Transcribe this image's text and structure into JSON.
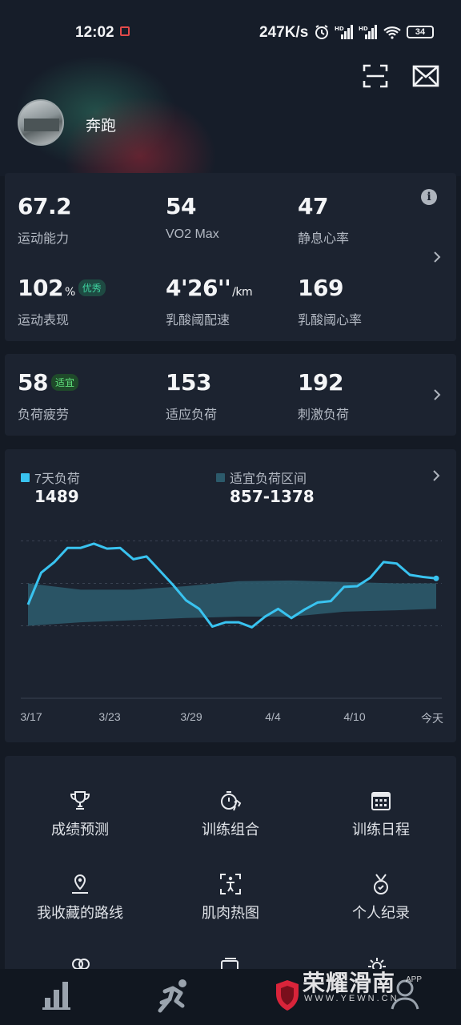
{
  "status_bar": {
    "time": "12:02",
    "net_speed": "247K/s",
    "battery": "34",
    "icons": [
      "alarm-icon",
      "signal-hd-icon",
      "signal-hd-icon",
      "wifi-icon",
      "battery-icon"
    ]
  },
  "header": {
    "username": "奔跑",
    "icons": [
      "scan-icon",
      "mail-icon"
    ]
  },
  "ability": {
    "metrics": [
      {
        "value": "67.2",
        "unit": "",
        "label": "运动能力",
        "badge": ""
      },
      {
        "value": "54",
        "unit": "",
        "label": "VO2 Max",
        "badge": ""
      },
      {
        "value": "47",
        "unit": "",
        "label": "静息心率",
        "badge": ""
      },
      {
        "value": "102",
        "unit": "%",
        "label": "运动表现",
        "badge": "优秀"
      },
      {
        "value": "4'26''",
        "unit": "/km",
        "label": "乳酸阈配速",
        "badge": ""
      },
      {
        "value": "169",
        "unit": "",
        "label": "乳酸阈心率",
        "badge": ""
      }
    ]
  },
  "load": {
    "metrics": [
      {
        "value": "58",
        "label": "负荷疲劳",
        "badge": "适宜"
      },
      {
        "value": "153",
        "label": "适应负荷",
        "badge": ""
      },
      {
        "value": "192",
        "label": "刺激负荷",
        "badge": ""
      }
    ]
  },
  "colors": {
    "accent_line": "#39c3f0",
    "band_fill": "#2c5a6b",
    "card_bg": "#1c2330",
    "badge_teal": "#3ed4a0",
    "badge_green": "#5fe07c"
  },
  "chart_data": {
    "type": "area",
    "legend": [
      {
        "label": "7天负荷",
        "value": "1489",
        "color": "#39c3f0"
      },
      {
        "label": "适宜负荷区间",
        "value": "857-1378",
        "color": "#2c5a6b"
      }
    ],
    "x_tick_labels": [
      "3/17",
      "3/23",
      "3/29",
      "4/4",
      "4/10",
      "今天"
    ],
    "ylim": [
      0,
      2600
    ],
    "grid": true,
    "series": [
      {
        "name": "7天负荷",
        "x": [
          0,
          1,
          2,
          3,
          4,
          5,
          6,
          7,
          8,
          9,
          10,
          11,
          12,
          13,
          14,
          15,
          16,
          17,
          18,
          19,
          20,
          21,
          22,
          23,
          24,
          25,
          26,
          27,
          28,
          29,
          30,
          31
        ],
        "values": [
          1300,
          1750,
          1900,
          2100,
          2100,
          2160,
          2090,
          2100,
          1940,
          1980,
          1780,
          1580,
          1360,
          1240,
          990,
          1050,
          1050,
          980,
          1130,
          1240,
          1110,
          1230,
          1330,
          1350,
          1550,
          1560,
          1680,
          1900,
          1880,
          1720,
          1690,
          1670
        ]
      },
      {
        "name": "适宜负荷区间",
        "x": [
          0,
          4,
          8,
          12,
          16,
          20,
          24,
          28,
          31
        ],
        "upper": [
          1600,
          1510,
          1510,
          1560,
          1630,
          1640,
          1620,
          1600,
          1600
        ],
        "lower": [
          1000,
          1050,
          1080,
          1110,
          1130,
          1130,
          1200,
          1220,
          1240
        ]
      }
    ]
  },
  "menu": {
    "items": [
      {
        "label": "成绩预测",
        "icon": "trophy-icon"
      },
      {
        "label": "训练组合",
        "icon": "stopwatch-run-icon"
      },
      {
        "label": "训练日程",
        "icon": "calendar-icon"
      },
      {
        "label": "我收藏的路线",
        "icon": "route-pin-icon"
      },
      {
        "label": "肌肉热图",
        "icon": "muscle-scan-icon"
      },
      {
        "label": "个人纪录",
        "icon": "medal-icon"
      }
    ]
  },
  "bottom_nav": {
    "icons": [
      "stats-icon",
      "running-icon",
      "shield-icon",
      "profile-icon"
    ]
  },
  "watermark": {
    "text": "荣耀滑南",
    "url": "WWW.YEWN.CN",
    "app": "APP"
  }
}
